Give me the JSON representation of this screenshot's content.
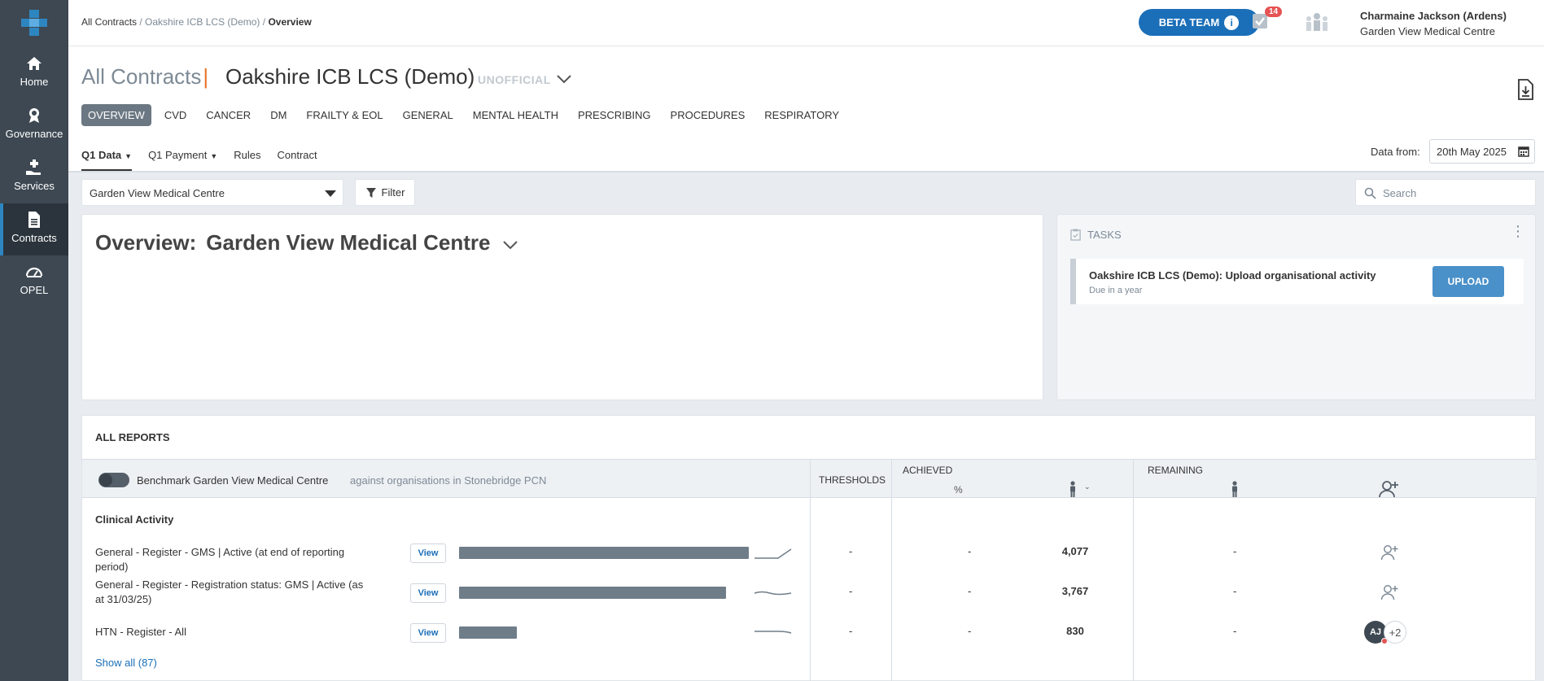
{
  "sidebar": {
    "items": [
      {
        "label": "Home",
        "icon": "home-icon"
      },
      {
        "label": "Governance",
        "icon": "governance-icon"
      },
      {
        "label": "Services",
        "icon": "services-icon"
      },
      {
        "label": "Contracts",
        "icon": "contracts-icon",
        "active": true
      },
      {
        "label": "OPEL",
        "icon": "gauge-icon"
      }
    ]
  },
  "header": {
    "breadcrumb": {
      "root": "All Contracts",
      "sep1": " / ",
      "middle": "Oakshire ICB LCS (Demo)",
      "sep2": " / ",
      "current": "Overview"
    },
    "beta_label": "BETA TEAM",
    "tasks_count": "14",
    "user_name": "Charmaine Jackson (Ardens)",
    "user_org": "Garden View Medical Centre"
  },
  "page": {
    "title": "All Contracts",
    "title_sep": "|",
    "contract": "Oakshire ICB LCS (Demo)",
    "status": "UNOFFICIAL",
    "tabs": [
      "OVERVIEW",
      "CVD",
      "CANCER",
      "DM",
      "FRAILTY & EOL",
      "GENERAL",
      "MENTAL HEALTH",
      "PRESCRIBING",
      "PROCEDURES",
      "RESPIRATORY"
    ],
    "subtabs": [
      "Q1 Data",
      "Q1 Payment",
      "Rules",
      "Contract"
    ],
    "data_from_label": "Data from:",
    "data_from_value": "20th May 2025"
  },
  "filters": {
    "org_value": "Garden View Medical Centre",
    "filter_label": "Filter",
    "search_placeholder": "Search"
  },
  "overview": {
    "prefix": "Overview:",
    "org": "Garden View Medical Centre"
  },
  "tasks": {
    "heading": "TASKS",
    "items": [
      {
        "title": "Oakshire ICB LCS (Demo): Upload organisational activity",
        "due": "Due in a year",
        "action": "UPLOAD"
      }
    ]
  },
  "reports": {
    "title": "ALL REPORTS",
    "benchmark_label": "Benchmark Garden View Medical Centre",
    "benchmark_against": "against organisations in Stonebridge PCN",
    "col_thresholds": "THRESHOLDS",
    "col_achieved": "ACHIEVED",
    "col_pct": "%",
    "col_remaining": "REMAINING",
    "section": "Clinical Activity",
    "view_label": "View",
    "rows": [
      {
        "label": "General - Register - GMS | Active (at end of reporting period)",
        "bar_fraction": 1.0,
        "threshold": "-",
        "achieved_pct": "-",
        "achieved_count": "4,077",
        "remaining": "-"
      },
      {
        "label": "General - Register - Registration status: GMS | Active (as at 31/03/25)",
        "bar_fraction": 0.92,
        "threshold": "-",
        "achieved_pct": "-",
        "achieved_count": "3,767",
        "remaining": "-"
      },
      {
        "label": "HTN - Register - All",
        "bar_fraction": 0.2,
        "threshold": "-",
        "achieved_pct": "-",
        "achieved_count": "830",
        "remaining": "-",
        "assignee_initials": "AJ",
        "assignee_more": "+2"
      }
    ],
    "show_all": "Show all (87)"
  },
  "colors": {
    "sidebar": "#3d4852",
    "accent": "#1b6fb8",
    "brand_orange": "#e8742a",
    "bar": "#6f7d89"
  }
}
